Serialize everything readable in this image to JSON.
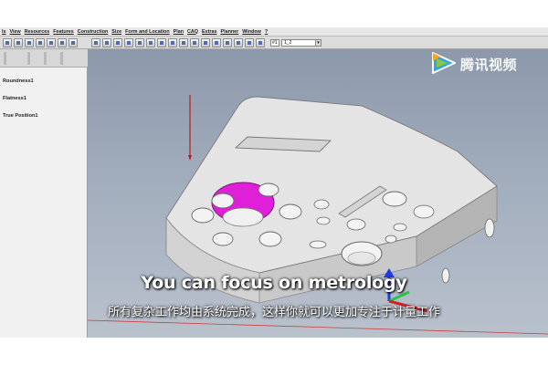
{
  "menu": {
    "items": [
      "ls",
      "View",
      "Resources",
      "Features",
      "Construction",
      "Size",
      "Form and Location",
      "Plan",
      "CAQ",
      "Extras",
      "Planner",
      "Window",
      "?"
    ]
  },
  "toolbar": {
    "field_value": "#1",
    "select_value": "1_2"
  },
  "feature_list": {
    "items": [
      "Roundness1",
      "Flatness1",
      "True Position1"
    ]
  },
  "watermark": {
    "text": "腾讯视频",
    "brand_colors": [
      "#2fa6e6",
      "#8cc63f",
      "#f5a623"
    ]
  },
  "subtitles": {
    "english": "You can focus on metrology",
    "chinese": "所有复杂工作均由系统完成，这样你就可以更加专注于计量工作"
  },
  "colors": {
    "highlight": "#e020d8",
    "part": "#e4e4e4",
    "viewport_bg": "#9aa6b6"
  }
}
